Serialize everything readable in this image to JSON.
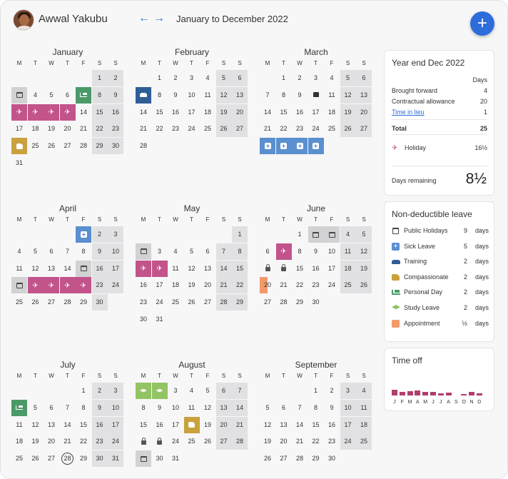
{
  "user": {
    "name": "Awwal Yakubu"
  },
  "header": {
    "range": "January to December 2022",
    "prev": "←",
    "next": "→",
    "add": "+"
  },
  "weekdays": [
    "M",
    "T",
    "W",
    "T",
    "F",
    "S",
    "S"
  ],
  "months": [
    {
      "name": "January",
      "start": 5,
      "days": 31,
      "events": {
        "3": "pub",
        "7": "pers",
        "10": "hol",
        "11": "hol",
        "12": "hol",
        "13": "hol",
        "24": "comp"
      }
    },
    {
      "name": "February",
      "start": 1,
      "days": 28,
      "events": {
        "7": "train"
      }
    },
    {
      "name": "March",
      "start": 1,
      "days": 31,
      "events": {
        "10": "cake",
        "28": "sick",
        "29": "sick",
        "30": "sick",
        "31": "sick"
      }
    },
    {
      "name": "April",
      "start": 4,
      "days": 30,
      "events": {
        "1": "sick",
        "15": "pub",
        "18": "pub",
        "19": "hol",
        "20": "hol",
        "21": "hol",
        "22": "hol"
      }
    },
    {
      "name": "May",
      "start": 6,
      "days": 31,
      "events": {
        "2": "pub",
        "9": "hol",
        "10": "hol"
      }
    },
    {
      "name": "June",
      "start": 2,
      "days": 30,
      "events": {
        "2": "pub",
        "3": "pub",
        "7": "hol",
        "13": "lock",
        "14": "lock",
        "20": "appt"
      }
    },
    {
      "name": "July",
      "start": 4,
      "days": 31,
      "events": {
        "4": "pers",
        "28": "today"
      }
    },
    {
      "name": "August",
      "start": 0,
      "days": 31,
      "events": {
        "1": "study",
        "2": "study",
        "18": "comp",
        "22": "lock",
        "23": "lock",
        "29": "pub"
      }
    },
    {
      "name": "September",
      "start": 3,
      "days": 30,
      "events": {}
    }
  ],
  "year_end": {
    "title": "Year end Dec 2022",
    "days_label": "Days",
    "rows": [
      {
        "label": "Brought forward",
        "value": "4"
      },
      {
        "label": "Contractual allowance",
        "value": "20"
      },
      {
        "label": "Time in lieu",
        "value": "1"
      }
    ],
    "total_label": "Total",
    "total_value": "25",
    "holiday_label": "Holiday",
    "holiday_value": "16½",
    "remaining_label": "Days remaining",
    "remaining_value": "8½"
  },
  "non_deductible": {
    "title": "Non-deductible leave",
    "items": [
      {
        "label": "Public Holidays",
        "count": "9",
        "unit": "days",
        "icon": "calendar-icon"
      },
      {
        "label": "Sick Leave",
        "count": "5",
        "unit": "days",
        "icon": "sick-plus-icon"
      },
      {
        "label": "Training",
        "count": "2",
        "unit": "days",
        "icon": "training-people-icon"
      },
      {
        "label": "Compassionate",
        "count": "2",
        "unit": "days",
        "icon": "compassionate-hand-icon"
      },
      {
        "label": "Personal Day",
        "count": "2",
        "unit": "days",
        "icon": "personal-bed-icon"
      },
      {
        "label": "Study Leave",
        "count": "2",
        "unit": "days",
        "icon": "graduation-cap-icon"
      },
      {
        "label": "Appointment",
        "count": "½",
        "unit": "days",
        "icon": "appointment-square-icon"
      }
    ]
  },
  "time_off": {
    "title": "Time off",
    "months": [
      "J",
      "F",
      "M",
      "A",
      "M",
      "J",
      "J",
      "A",
      "S",
      "O",
      "N",
      "D"
    ],
    "values": [
      5,
      3,
      3.5,
      4.5,
      3,
      3,
      2,
      2.5,
      0,
      1,
      3,
      2
    ]
  },
  "colors": {
    "accent": "#2d6ddb",
    "holiday": "#c2548b",
    "sick": "#5a8fd0",
    "training": "#2f5e96",
    "compassionate": "#c9a13d",
    "personal": "#4a9a68",
    "study": "#93c464",
    "appointment": "#f29a6a",
    "bar": "#b13e6f"
  }
}
